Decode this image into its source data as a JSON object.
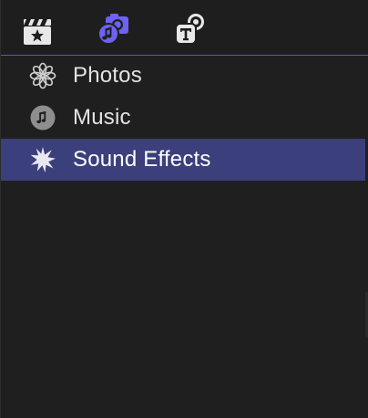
{
  "toolbar": {
    "buttons": [
      {
        "name": "media-browser",
        "icon": "clapperboard-star-icon",
        "active": false
      },
      {
        "name": "photos-and-audio",
        "icon": "photo-music-icon",
        "active": true
      },
      {
        "name": "titles-generators",
        "icon": "titles-icon",
        "active": false
      }
    ],
    "accent_color": "#5a55d6"
  },
  "sidebar": {
    "items": [
      {
        "label": "Photos",
        "icon": "photos-flower-icon",
        "selected": false
      },
      {
        "label": "Music",
        "icon": "music-note-icon",
        "selected": false
      },
      {
        "label": "Sound Effects",
        "icon": "starburst-icon",
        "selected": true
      }
    ],
    "selection_color": "#3b3f7c"
  }
}
